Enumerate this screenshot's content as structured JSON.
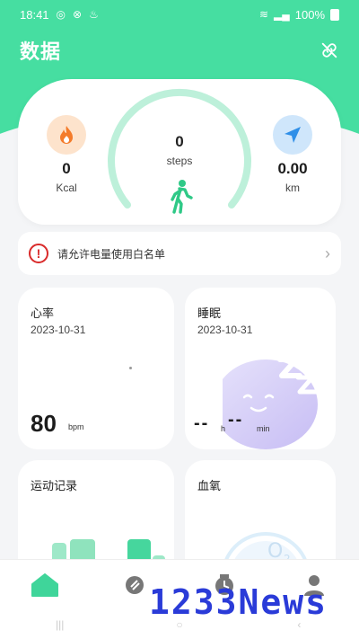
{
  "status_bar": {
    "time": "18:41",
    "battery": "100%"
  },
  "header": {
    "title": "数据"
  },
  "summary": {
    "calories": {
      "value": "0",
      "unit": "Kcal"
    },
    "steps": {
      "value": "0",
      "label": "steps"
    },
    "distance": {
      "value": "0.00",
      "unit": "km"
    }
  },
  "notice": {
    "text": "请允许电量使用白名单"
  },
  "heart_rate": {
    "title": "心率",
    "date": "2023-10-31",
    "value": "80",
    "unit": "bpm"
  },
  "sleep": {
    "title": "睡眠",
    "date": "2023-10-31",
    "hours": "--",
    "hours_unit": "h",
    "minutes": "--",
    "minutes_unit": "min"
  },
  "exercise": {
    "title": "运动记录"
  },
  "oxygen": {
    "title": "血氧"
  },
  "watermark": "1233News",
  "colors": {
    "brand": "#46dea1",
    "calorie": "#f47b2a",
    "distance": "#2f8fe8",
    "alert": "#d92a2a"
  },
  "nav": [
    "home-icon",
    "watch-icon",
    "clock-icon",
    "profile-icon"
  ]
}
